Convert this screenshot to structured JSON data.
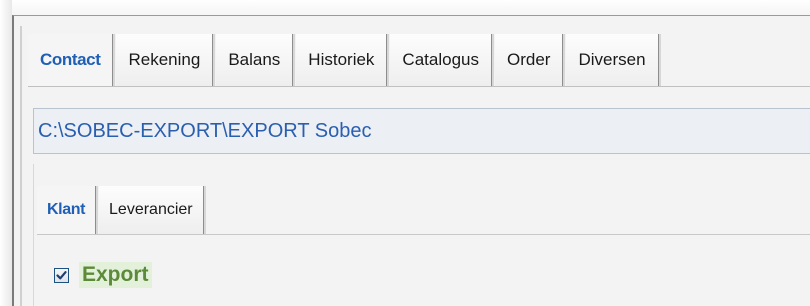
{
  "main_tabs": [
    {
      "label": "Contact",
      "active": true
    },
    {
      "label": "Rekening",
      "active": false
    },
    {
      "label": "Balans",
      "active": false
    },
    {
      "label": "Historiek",
      "active": false
    },
    {
      "label": "Catalogus",
      "active": false
    },
    {
      "label": "Order",
      "active": false
    },
    {
      "label": "Diversen",
      "active": false
    }
  ],
  "path_field": {
    "value": "C:\\SOBEC-EXPORT\\EXPORT Sobec"
  },
  "sub_tabs": [
    {
      "label": "Klant",
      "active": true
    },
    {
      "label": "Leverancier",
      "active": false
    }
  ],
  "export_checkbox": {
    "label": "Export",
    "checked": true
  },
  "colors": {
    "active_tab_text": "#1f5fb5",
    "path_text": "#2a5fb0",
    "export_label": "#5d8a3a",
    "export_label_bg": "#e3f1da"
  },
  "icons": {
    "checkbox_mark": "checkmark-icon"
  }
}
